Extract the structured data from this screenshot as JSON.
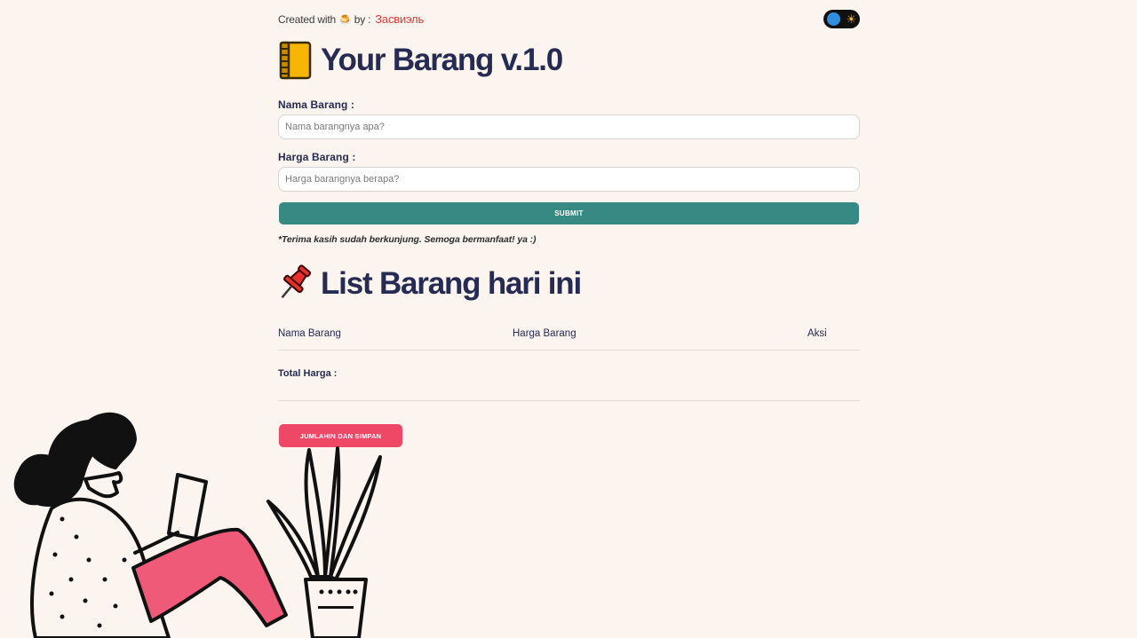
{
  "credit": {
    "prefix": "Created with",
    "emoji": "🍮",
    "by": "by :",
    "author": "Засвиэль"
  },
  "theme_toggle": {
    "icon": "sun-icon",
    "sun_glyph": "☀"
  },
  "header": {
    "title": "Your Barang v.1.0",
    "title_icon": "notebook-icon"
  },
  "form": {
    "name_label": "Nama Barang :",
    "name_placeholder": "Nama barangnya apa?",
    "price_label": "Harga Barang :",
    "price_placeholder": "Harga barangnya berapa?",
    "submit_label": "SUBMIT",
    "note": "*Terima kasih sudah berkunjung. Semoga bermanfaat! ya :)"
  },
  "list": {
    "title": "List Barang hari ini",
    "title_icon": "pushpin-icon",
    "columns": [
      "Nama Barang",
      "Harga Barang",
      "Aksi"
    ],
    "rows": [],
    "total_label": "Total Harga :",
    "sum_button_label": "JUMLAHIN DAN SIMPAN"
  },
  "colors": {
    "background": "#fbf4ef",
    "heading": "#252b52",
    "submit": "#378a83",
    "sum_button": "#ef4866",
    "author": "#e53935"
  }
}
